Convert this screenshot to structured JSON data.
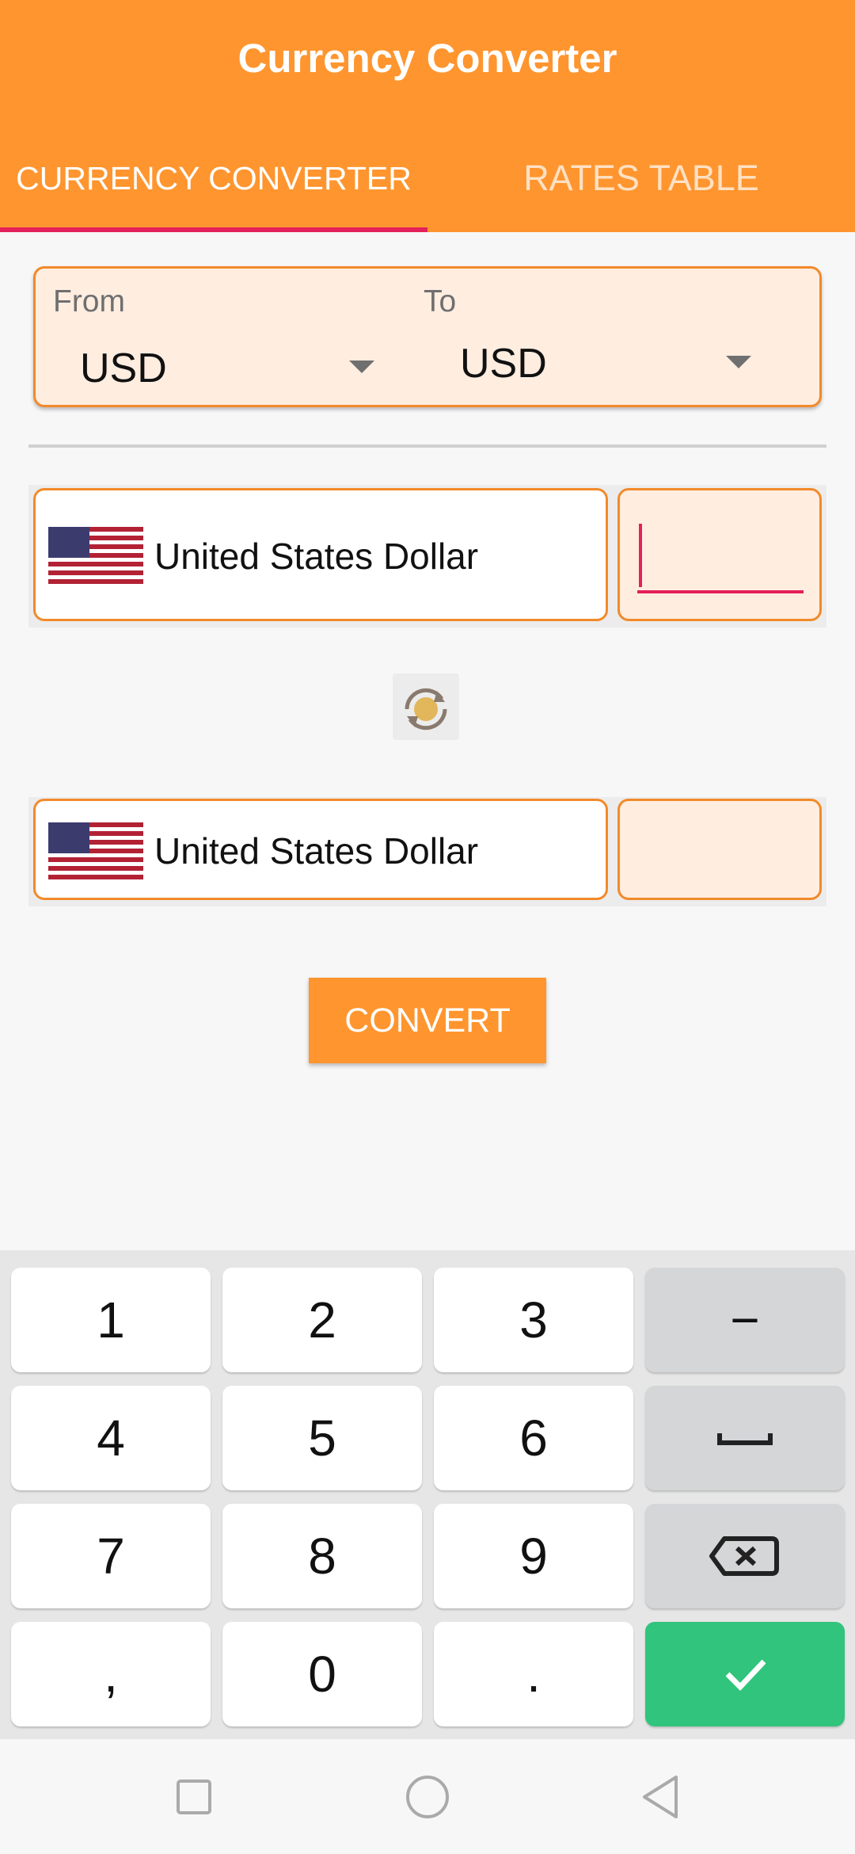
{
  "header": {
    "title": "Currency Converter",
    "tabs": [
      {
        "label": "CURRENCY CONVERTER",
        "active": true
      },
      {
        "label": "RATES TABLE",
        "active": false
      }
    ],
    "bg_color": "#ff952e",
    "indicator_color": "#e4215a"
  },
  "selector": {
    "from_label": "From",
    "from_value": "USD",
    "to_label": "To",
    "to_value": "USD"
  },
  "from_row": {
    "flag_icon": "us-flag-icon",
    "currency_name": "United States Dollar",
    "amount": ""
  },
  "swap": {
    "icon": "swap-icon"
  },
  "to_row": {
    "flag_icon": "us-flag-icon",
    "currency_name": "United States Dollar",
    "amount": ""
  },
  "convert_label": "CONVERT",
  "keyboard": {
    "keys": [
      "1",
      "2",
      "3",
      "−",
      "4",
      "5",
      "6",
      "space",
      "7",
      "8",
      "9",
      "backspace",
      ",",
      "0",
      ".",
      "done"
    ],
    "k1": "1",
    "k2": "2",
    "k3": "3",
    "minus": "−",
    "k4": "4",
    "k5": "5",
    "k6": "6",
    "k7": "7",
    "k8": "8",
    "k9": "9",
    "comma": ",",
    "k0": "0",
    "dot": ".",
    "accent": "#30c47c"
  },
  "navbar": {
    "icons": [
      "recents-icon",
      "home-icon",
      "back-icon"
    ]
  }
}
